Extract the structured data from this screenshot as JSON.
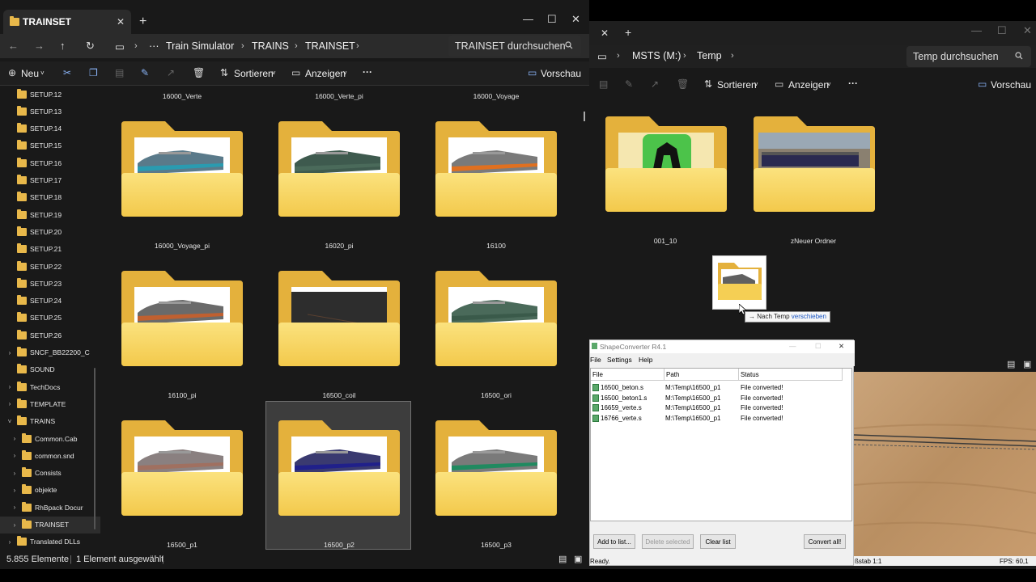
{
  "left_window": {
    "tab_title": "TRAINSET",
    "breadcrumb": [
      "Train Simulator",
      "TRAINS",
      "TRAINSET"
    ],
    "search_placeholder": "TRAINSET durchsuchen",
    "commands": {
      "new": "Neu",
      "sort": "Sortieren",
      "view": "Anzeigen",
      "preview": "Vorschau"
    },
    "nav_items": [
      {
        "label": "SETUP.12",
        "level": 1,
        "expand": ""
      },
      {
        "label": "SETUP.13",
        "level": 1,
        "expand": ""
      },
      {
        "label": "SETUP.14",
        "level": 1,
        "expand": ""
      },
      {
        "label": "SETUP.15",
        "level": 1,
        "expand": ""
      },
      {
        "label": "SETUP.16",
        "level": 1,
        "expand": ""
      },
      {
        "label": "SETUP.17",
        "level": 1,
        "expand": ""
      },
      {
        "label": "SETUP.18",
        "level": 1,
        "expand": ""
      },
      {
        "label": "SETUP.19",
        "level": 1,
        "expand": ""
      },
      {
        "label": "SETUP.20",
        "level": 1,
        "expand": ""
      },
      {
        "label": "SETUP.21",
        "level": 1,
        "expand": ""
      },
      {
        "label": "SETUP.22",
        "level": 1,
        "expand": ""
      },
      {
        "label": "SETUP.23",
        "level": 1,
        "expand": ""
      },
      {
        "label": "SETUP.24",
        "level": 1,
        "expand": ""
      },
      {
        "label": "SETUP.25",
        "level": 1,
        "expand": ""
      },
      {
        "label": "SETUP.26",
        "level": 1,
        "expand": ""
      },
      {
        "label": "SNCF_BB22200_C",
        "level": 1,
        "expand": ">"
      },
      {
        "label": "SOUND",
        "level": 1,
        "expand": ""
      },
      {
        "label": "TechDocs",
        "level": 1,
        "expand": ">"
      },
      {
        "label": "TEMPLATE",
        "level": 1,
        "expand": ">"
      },
      {
        "label": "TRAINS",
        "level": 1,
        "expand": "v"
      },
      {
        "label": "Common.Cab",
        "level": 2,
        "expand": ">"
      },
      {
        "label": "common.snd",
        "level": 2,
        "expand": ">"
      },
      {
        "label": "Consists",
        "level": 2,
        "expand": ">"
      },
      {
        "label": "objekte",
        "level": 2,
        "expand": ">"
      },
      {
        "label": "RhBpack Docur",
        "level": 2,
        "expand": ">"
      },
      {
        "label": "TRAINSET",
        "level": 2,
        "expand": ">",
        "selected": true
      },
      {
        "label": "Translated DLLs",
        "level": 1,
        "expand": ">"
      }
    ],
    "top_labels": [
      "16000_Verte",
      "16000_Verte_pi",
      "16000_Voyage"
    ],
    "folders": [
      {
        "label": "16000_Voyage_pi",
        "color": "#5a7a8a",
        "accent": "#2a9bb0"
      },
      {
        "label": "16020_pi",
        "color": "#3e5a4e",
        "accent": "#4a6a5a"
      },
      {
        "label": "16100",
        "color": "#7a7a7a",
        "accent": "#e07020"
      },
      {
        "label": "16100_pi",
        "color": "#6a6a6a",
        "accent": "#c06030"
      },
      {
        "label": "16500_coil",
        "color": "#3a3a3a",
        "accent": "#555555",
        "dark": true
      },
      {
        "label": "16500_ori",
        "color": "#4a6a5a",
        "accent": "#3a5a4a"
      },
      {
        "label": "16500_p1",
        "color": "#8a8080",
        "accent": "#a07060"
      },
      {
        "label": "16500_p2",
        "color": "#3a3a70",
        "accent": "#20208a",
        "selected": true
      },
      {
        "label": "16500_p3",
        "color": "#7a7a7a",
        "accent": "#208a60"
      }
    ],
    "status": {
      "count": "5.855 Elemente",
      "selection": "1 Element ausgewählt"
    }
  },
  "right_window": {
    "breadcrumb": [
      "MSTS (M:)",
      "Temp"
    ],
    "search_placeholder": "Temp durchsuchen",
    "commands": {
      "sort": "Sortieren",
      "view": "Anzeigen",
      "preview": "Vorschau"
    },
    "folders": [
      {
        "label": "001_10"
      },
      {
        "label": "zNeuer Ordner"
      }
    ]
  },
  "drag": {
    "tooltip_prefix": "Nach Temp",
    "tooltip_action": "verschieben"
  },
  "shape_converter": {
    "title": "ShapeConverter R4.1",
    "menu": [
      "File",
      "Settings",
      "Help"
    ],
    "columns": [
      "File",
      "Path",
      "Status"
    ],
    "rows": [
      {
        "file": "16500_beton.s",
        "path": "M:\\Temp\\16500_p1",
        "status": "File converted!"
      },
      {
        "file": "16500_beton1.s",
        "path": "M:\\Temp\\16500_p1",
        "status": "File converted!"
      },
      {
        "file": "16659_verte.s",
        "path": "M:\\Temp\\16500_p1",
        "status": "File converted!"
      },
      {
        "file": "16766_verte.s",
        "path": "M:\\Temp\\16500_p1",
        "status": "File converted!"
      }
    ],
    "buttons": {
      "add": "Add to list...",
      "delete": "Delete selected",
      "clear": "Clear list",
      "convert": "Convert all!"
    },
    "status": "Ready."
  },
  "viewport": {
    "scale": "ßstab 1:1",
    "fps": "FPS: 60,1"
  },
  "colors": {
    "folder_yellow": "#f3c94b",
    "dark_bg": "#191919",
    "accent": "#8ab4f8"
  }
}
